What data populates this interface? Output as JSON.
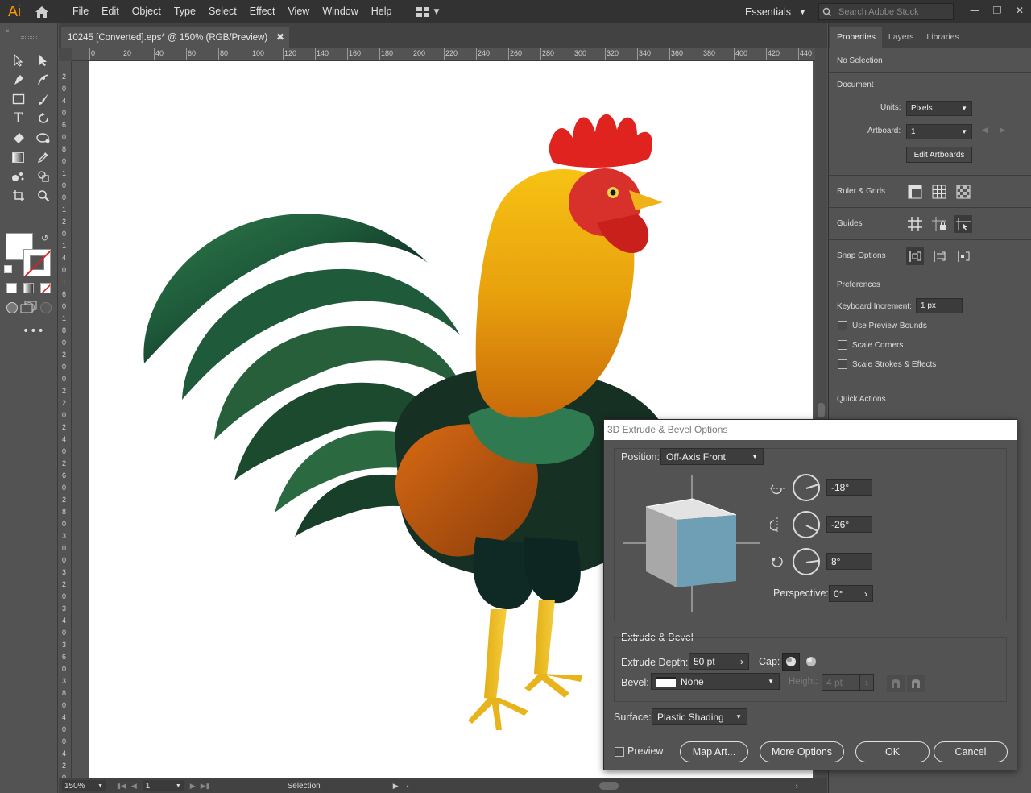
{
  "app": {
    "logo": "Ai"
  },
  "menu": [
    "File",
    "Edit",
    "Object",
    "Type",
    "Select",
    "Effect",
    "View",
    "Window",
    "Help"
  ],
  "workspace": "Essentials",
  "stock_search_placeholder": "Search Adobe Stock",
  "document": {
    "tab_title": "10245 [Converted].eps* @ 150% (RGB/Preview)",
    "ruler_h": [
      "0",
      "20",
      "40",
      "60",
      "80",
      "100",
      "120",
      "140",
      "160",
      "180",
      "200",
      "220",
      "240",
      "260",
      "280",
      "300",
      "320",
      "340",
      "360",
      "380",
      "400",
      "420",
      "440"
    ],
    "ruler_v": [
      "2",
      "0",
      "4",
      "0",
      "6",
      "0",
      "8",
      "0",
      "1",
      "0",
      "0",
      "1",
      "2",
      "0",
      "1",
      "4",
      "0",
      "1",
      "6",
      "0",
      "1",
      "8",
      "0",
      "2",
      "0",
      "0",
      "2",
      "2",
      "0",
      "2",
      "4",
      "0",
      "2",
      "6",
      "0",
      "2",
      "8",
      "0",
      "3",
      "0",
      "0",
      "3",
      "2",
      "0",
      "3",
      "4",
      "0",
      "3",
      "6",
      "0",
      "3",
      "8",
      "0",
      "4",
      "0",
      "0",
      "4",
      "2",
      "0"
    ]
  },
  "status": {
    "zoom": "150%",
    "artboard": "1",
    "tool": "Selection"
  },
  "panel": {
    "tabs": [
      "Properties",
      "Layers",
      "Libraries"
    ],
    "no_selection": "No Selection",
    "document_heading": "Document",
    "units_label": "Units:",
    "units_value": "Pixels",
    "artboard_label": "Artboard:",
    "artboard_value": "1",
    "edit_artboards": "Edit Artboards",
    "ruler_grids": "Ruler & Grids",
    "guides": "Guides",
    "snap_options": "Snap Options",
    "preferences": "Preferences",
    "keyboard_increment_label": "Keyboard Increment:",
    "keyboard_increment_value": "1 px",
    "use_preview_bounds": "Use Preview Bounds",
    "scale_corners": "Scale Corners",
    "scale_strokes": "Scale Strokes & Effects",
    "quick_actions": "Quick Actions"
  },
  "dialog": {
    "title": "3D Extrude & Bevel Options",
    "position_label": "Position:",
    "position_value": "Off-Axis Front",
    "rot_x": "-18°",
    "rot_y": "-26°",
    "rot_z": "8°",
    "perspective_label": "Perspective:",
    "perspective_value": "0°",
    "extrude_heading": "Extrude & Bevel",
    "extrude_depth_label": "Extrude Depth:",
    "extrude_depth_value": "50 pt",
    "cap_label": "Cap:",
    "bevel_label": "Bevel:",
    "bevel_value": "None",
    "height_label": "Height:",
    "height_value": "4 pt",
    "surface_label": "Surface:",
    "surface_value": "Plastic Shading",
    "preview_label": "Preview",
    "map_art": "Map Art...",
    "more_options": "More Options",
    "ok": "OK",
    "cancel": "Cancel",
    "cube_front_color": "#6e9fb5"
  }
}
